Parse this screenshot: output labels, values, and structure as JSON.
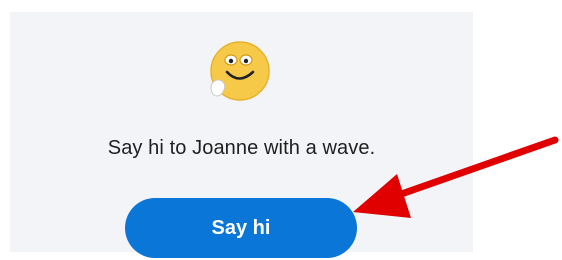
{
  "card": {
    "emoji_icon": "wave-emoji-icon",
    "message": "Say hi to Joanne with a wave.",
    "button_label": "Say hi",
    "button_color": "#0a76d8"
  },
  "annotation": {
    "arrow_color": "#e00000"
  }
}
